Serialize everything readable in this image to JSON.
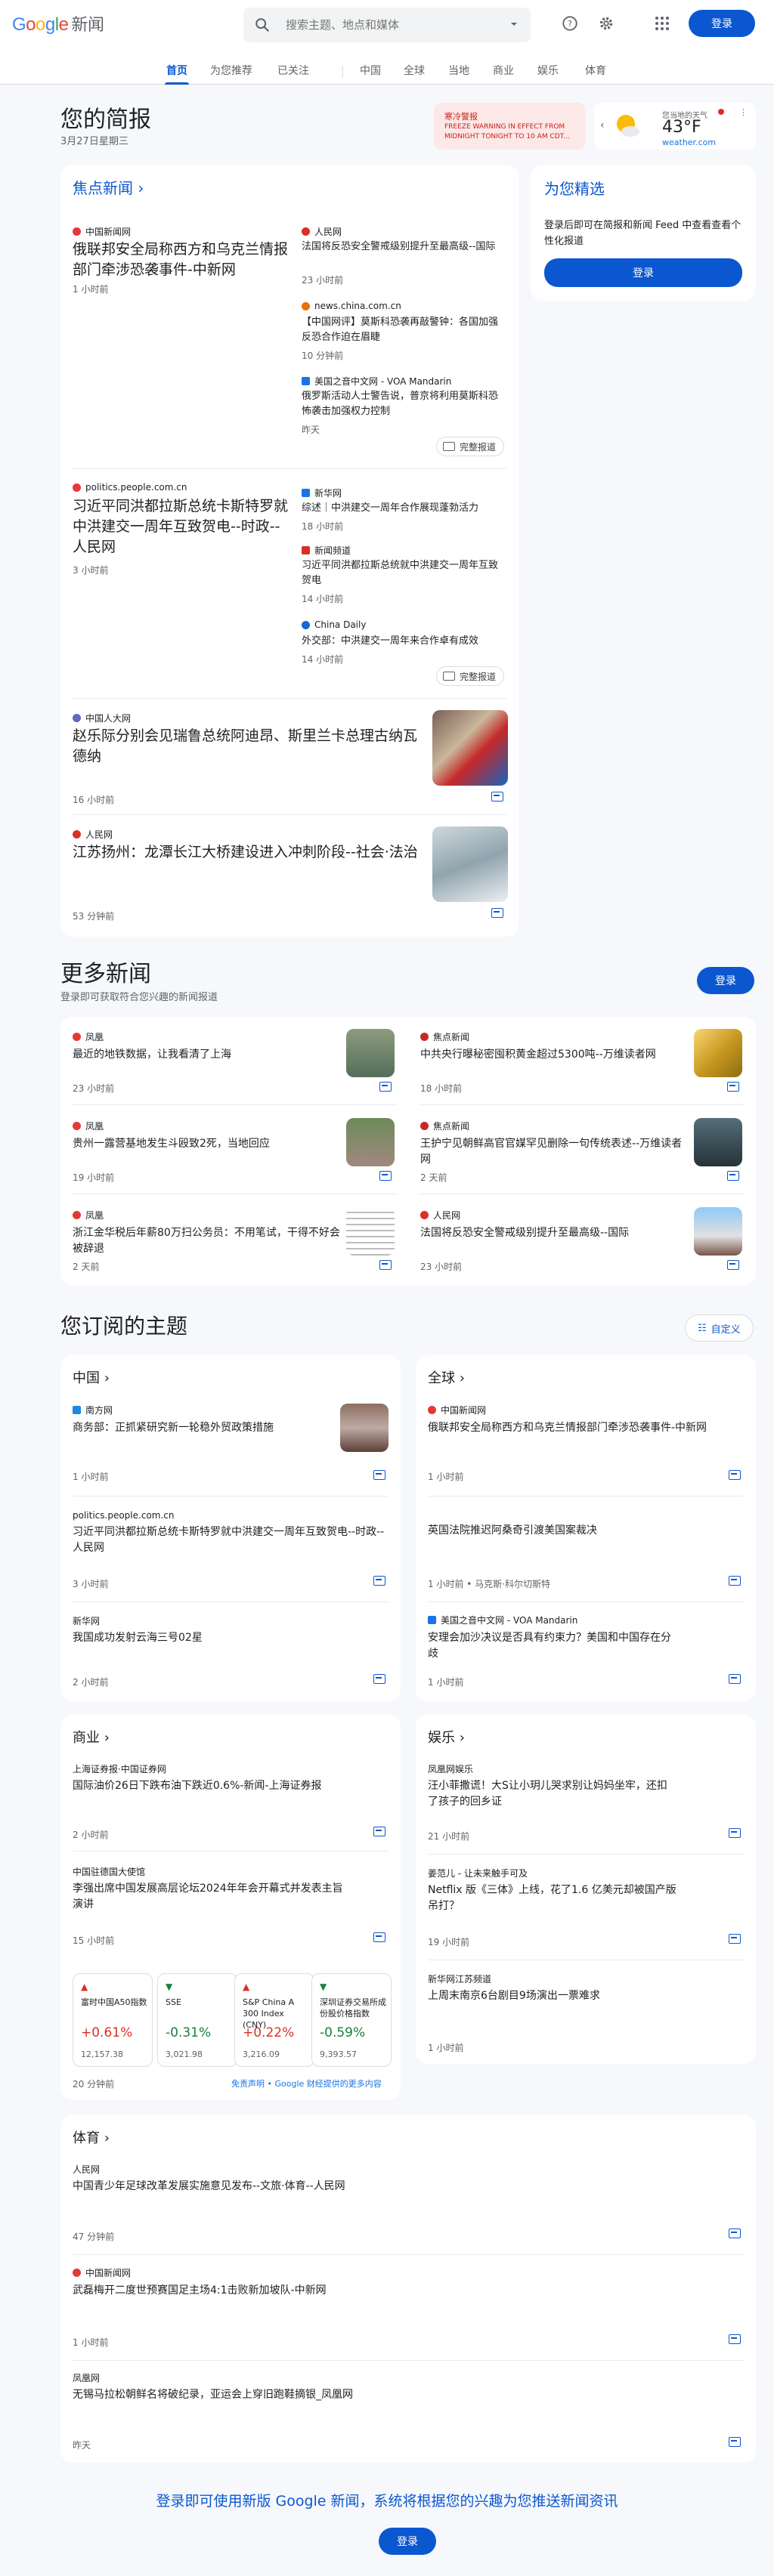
{
  "header": {
    "logo_g": "Google",
    "logo_news": "新闻",
    "search_placeholder": "搜索主题、地点和媒体",
    "login": "登录"
  },
  "tabs": [
    "首页",
    "为您推荐",
    "已关注",
    "中国",
    "全球",
    "当地",
    "商业",
    "娱乐",
    "体育"
  ],
  "briefing": {
    "title": "您的简报",
    "date": "3月27日星期三"
  },
  "alert": {
    "label": "寒冷警报",
    "text": "FREEZE WARNING IN EFFECT FROM MIDNIGHT TONIGHT TO 10 AM CDT..."
  },
  "weather": {
    "label": "您当地的天气",
    "temp": "43°F",
    "source": "weather.com"
  },
  "top": {
    "title": "焦点新闻",
    "full": "完整报道",
    "s1": {
      "src": "中国新闻网",
      "title": "俄联邦安全局称西方和乌克兰情报部门牵涉恐袭事件-中新网",
      "time": "1 小时前",
      "r": [
        {
          "src": "人民网",
          "title": "法国将反恐安全警戒级别提升至最高级--国际",
          "time": "23 小时前"
        },
        {
          "src": "news.china.com.cn",
          "title": "【中国网评】莫斯科恐袭再敲警钟：各国加强反恐合作迫在眉睫",
          "time": "10 分钟前"
        },
        {
          "src": "美国之音中文网 - VOA Mandarin",
          "title": "俄罗斯活动人士警告说，普京将利用莫斯科恐怖袭击加强权力控制",
          "time": "昨天"
        }
      ]
    },
    "s2": {
      "src": "politics.people.com.cn",
      "title": "习近平同洪都拉斯总统卡斯特罗就中洪建交一周年互致贺电--时政--人民网",
      "time": "3 小时前",
      "r": [
        {
          "src": "新华网",
          "title": "综述｜中洪建交一周年合作展现蓬勃活力",
          "time": "18 小时前"
        },
        {
          "src": "新闻频道",
          "title": "习近平同洪都拉斯总统就中洪建交一周年互致贺电",
          "time": "14 小时前"
        },
        {
          "src": "China Daily",
          "title": "外交部：中洪建交一周年来合作卓有成效",
          "time": "14 小时前"
        }
      ]
    },
    "s3": {
      "src": "中国人大网",
      "title": "赵乐际分别会见瑞鲁总统阿迪昂、斯里兰卡总理古纳瓦德纳",
      "time": "16 小时前"
    },
    "s4": {
      "src": "人民网",
      "title": "江苏扬州：龙潭长江大桥建设进入冲刺阶段--社会·法治",
      "time": "53 分钟前"
    }
  },
  "picks": {
    "title": "为您精选",
    "text": "登录后即可在简报和新闻 Feed 中查看查看个性化报道",
    "login": "登录"
  },
  "more": {
    "title": "更多新闻",
    "sub": "登录即可获取符合您兴趣的新闻报道",
    "login": "登录",
    "items": [
      {
        "src": "凤凰",
        "title": "最近的地铁数据，让我看清了上海",
        "time": "23 小时前"
      },
      {
        "src": "焦点新闻",
        "title": "中共央行曝秘密囤积黄金超过5300吨--万维读者网",
        "time": "18 小时前"
      },
      {
        "src": "凤凰",
        "title": "贵州一露营基地发生斗殴致2死，当地回应",
        "time": "19 小时前"
      },
      {
        "src": "焦点新闻",
        "title": "王护宁见朝鲜高官官媒罕见删除一句传统表述--万维读者网",
        "time": "2 天前"
      },
      {
        "src": "凤凰",
        "title": "浙江金华税后年薪80万扫公务员：不用笔试，干得不好会被辞退",
        "time": "2 天前"
      },
      {
        "src": "人民网",
        "title": "法国将反恐安全警戒级别提升至最高级--国际",
        "time": "23 小时前"
      }
    ]
  },
  "topics": {
    "title": "您订阅的主题",
    "customize": "自定义",
    "china": {
      "label": "中国",
      "items": [
        {
          "src": "南方网",
          "title": "商务部：正抓紧研究新一轮稳外贸政策措施",
          "time": "1 小时前"
        },
        {
          "src": "politics.people.com.cn",
          "title": "习近平同洪都拉斯总统卡斯特罗就中洪建交一周年互致贺电--时政--人民网",
          "time": "3 小时前"
        },
        {
          "src": "新华网",
          "title": "我国成功发射云海三号02星",
          "time": "2 小时前"
        }
      ]
    },
    "world": {
      "label": "全球",
      "items": [
        {
          "src": "中国新闻网",
          "title": "俄联邦安全局称西方和乌克兰情报部门牵涉恐袭事件-中新网",
          "time": "1 小时前"
        },
        {
          "src": "",
          "title": "英国法院推迟阿桑奇引渡美国案裁决",
          "time": "1 小时前 • 马克斯·科尔切斯特"
        },
        {
          "src": "美国之音中文网 - VOA Mandarin",
          "title": "安理会加沙决议是否具有约束力？美国和中国存在分歧",
          "time": "1 小时前"
        }
      ]
    },
    "business": {
      "label": "商业",
      "items": [
        {
          "src": "上海证券报·中国证券网",
          "title": "国际油价26日下跌布油下跌近0.6%-新闻-上海证券报",
          "time": "2 小时前"
        },
        {
          "src": "中国驻德国大使馆",
          "title": "李强出席中国发展高层论坛2024年年会开幕式并发表主旨演讲",
          "time": "15 小时前"
        }
      ],
      "market": [
        {
          "name": "富时中国A50指数",
          "change": "+0.61%",
          "value": "12,157.38",
          "up": true
        },
        {
          "name": "SSE",
          "change": "-0.31%",
          "value": "3,021.98",
          "up": false
        },
        {
          "name": "S&P China A 300 Index (CNY)",
          "change": "+0.22%",
          "value": "3,216.09",
          "up": true
        },
        {
          "name": "深圳证券交易所成份股价格指数",
          "change": "-0.59%",
          "value": "9,393.57",
          "up": false
        }
      ],
      "mtime": "20 分钟前",
      "disclaimer": "免责声明 • Google 财经提供的更多内容"
    },
    "ent": {
      "label": "娱乐",
      "items": [
        {
          "src": "凤凰网娱乐",
          "title": "汪小菲撒谎！大S让小玥儿哭求别让妈妈坐牢，还扣了孩子的回乡证",
          "time": "21 小时前"
        },
        {
          "src": "姜范儿 - 让未来触手可及",
          "title": "Netflix 版《三体》上线，花了1.6 亿美元却被国产版吊打？",
          "time": "19 小时前"
        },
        {
          "src": "新华网江苏频道",
          "title": "上周末南京6台剧目9场演出一票难求",
          "time": "1 小时前"
        }
      ]
    },
    "sports": {
      "label": "体育",
      "items": [
        {
          "src": "人民网",
          "title": "中国青少年足球改革发展实施意见发布--文旅·体育--人民网",
          "time": "47 分钟前"
        },
        {
          "src": "中国新闻网",
          "title": "武磊梅开二度世预赛国足主场4:1击败新加坡队-中新网",
          "time": "1 小时前"
        },
        {
          "src": "凤凰网",
          "title": "无锡马拉松朝鲜名将破纪录，亚运会上穿旧跑鞋摘银_凤凰网",
          "time": "昨天"
        }
      ]
    }
  },
  "footer": {
    "text": "登录即可使用新版 Google 新闻，系统将根据您的兴趣为您推送新闻资讯",
    "login": "登录"
  }
}
